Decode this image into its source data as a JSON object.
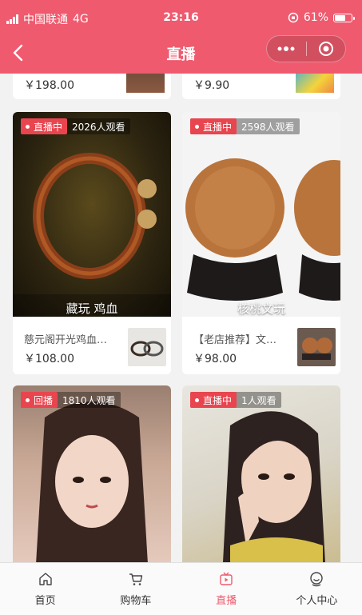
{
  "status_bar": {
    "carrier": "中国联通",
    "network": "4G",
    "time": "23:16",
    "battery": "61%"
  },
  "nav": {
    "title": "直播"
  },
  "top_row": [
    {
      "price": "￥198.00"
    },
    {
      "price": "￥9.90"
    }
  ],
  "streams": [
    {
      "status": "直播中",
      "viewers": "2026人观看",
      "caption": "藏玩 鸡血",
      "name": "慈元阁开光鸡血…",
      "price": "￥108.00"
    },
    {
      "status": "直播中",
      "viewers": "2598人观看",
      "caption": "核桃文玩",
      "name": "【老店推荐】文…",
      "price": "￥98.00"
    },
    {
      "status": "回播",
      "viewers": "1810人观看"
    },
    {
      "status": "直播中",
      "viewers": "1人观看"
    }
  ],
  "tabbar": [
    {
      "label": "首页",
      "icon": "home-icon"
    },
    {
      "label": "购物车",
      "icon": "cart-icon"
    },
    {
      "label": "直播",
      "icon": "live-icon"
    },
    {
      "label": "个人中心",
      "icon": "user-center-icon"
    }
  ],
  "colors": {
    "brand": "#ef5a6e",
    "live_badge": "#e8454f",
    "active_tab": "#ef5a6e"
  }
}
